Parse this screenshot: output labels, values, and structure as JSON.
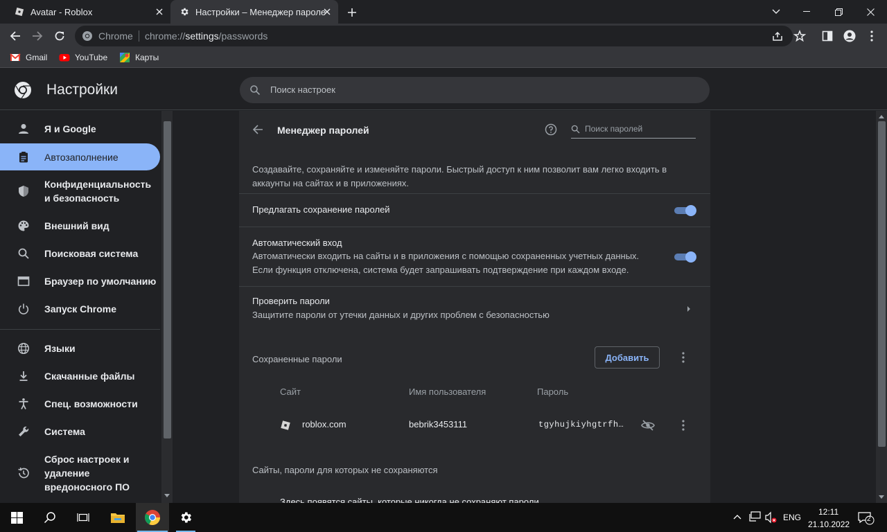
{
  "browser": {
    "tabs": [
      {
        "title": "Avatar - Roblox",
        "icon": "roblox-icon"
      },
      {
        "title": "Настройки – Менеджер пароле",
        "icon": "gear-icon"
      }
    ],
    "omnibox": {
      "origin": "Chrome",
      "url_prefix": "chrome://",
      "url_host": "settings",
      "url_path": "/passwords"
    },
    "bookmarks": [
      {
        "label": "Gmail",
        "icon": "gmail-icon"
      },
      {
        "label": "YouTube",
        "icon": "youtube-icon"
      },
      {
        "label": "Карты",
        "icon": "maps-icon"
      }
    ]
  },
  "settings": {
    "title": "Настройки",
    "search_placeholder": "Поиск настроек",
    "nav": [
      {
        "label": "Я и Google",
        "icon": "person-icon"
      },
      {
        "label": "Автозаполнение",
        "icon": "clipboard-icon"
      },
      {
        "label": "Конфиденциальность и безопасность",
        "icon": "shield-icon"
      },
      {
        "label": "Внешний вид",
        "icon": "palette-icon"
      },
      {
        "label": "Поисковая система",
        "icon": "search-icon"
      },
      {
        "label": "Браузер по умолчанию",
        "icon": "browser-icon"
      },
      {
        "label": "Запуск Chrome",
        "icon": "power-icon"
      },
      {
        "label": "Языки",
        "icon": "globe-icon"
      },
      {
        "label": "Скачанные файлы",
        "icon": "download-icon"
      },
      {
        "label": "Спец. возможности",
        "icon": "accessibility-icon"
      },
      {
        "label": "Система",
        "icon": "wrench-icon"
      },
      {
        "label": "Сброс настроек и удаление вредоносного ПО",
        "icon": "restore-icon"
      }
    ]
  },
  "passwords": {
    "title": "Менеджер паролей",
    "search_placeholder": "Поиск паролей",
    "description": "Создавайте, сохраняйте и изменяйте пароли. Быстрый доступ к ним позволит вам легко входить в аккаунты на сайтах и в приложениях.",
    "offer_save_label": "Предлагать сохранение паролей",
    "offer_save_on": true,
    "auto_signin_label": "Автоматический вход",
    "auto_signin_desc": "Автоматически входить на сайты и в приложения с помощью сохраненных учетных данных. Если функция отключена, система будет запрашивать подтверждение при каждом входе.",
    "auto_signin_on": true,
    "check_label": "Проверить пароли",
    "check_desc": "Защитите пароли от утечки данных и других проблем с безопасностью",
    "saved_label": "Сохраненные пароли",
    "add_button": "Добавить",
    "columns": {
      "site": "Сайт",
      "username": "Имя пользователя",
      "password": "Пароль"
    },
    "entries": [
      {
        "site": "roblox.com",
        "username": "bebrik3453111",
        "password": "tgyhujkiyhgtrfh…"
      }
    ],
    "never_saved_label": "Сайты, пароли для которых не сохраняются",
    "never_saved_desc": "Здесь появятся сайты, которые никогда не сохраняют пароли"
  },
  "taskbar": {
    "lang": "ENG",
    "time": "12:11",
    "date": "21.10.2022",
    "notifications": "2"
  },
  "colors": {
    "accent": "#8ab4f8",
    "background": "#202124",
    "card": "#292a2d"
  }
}
